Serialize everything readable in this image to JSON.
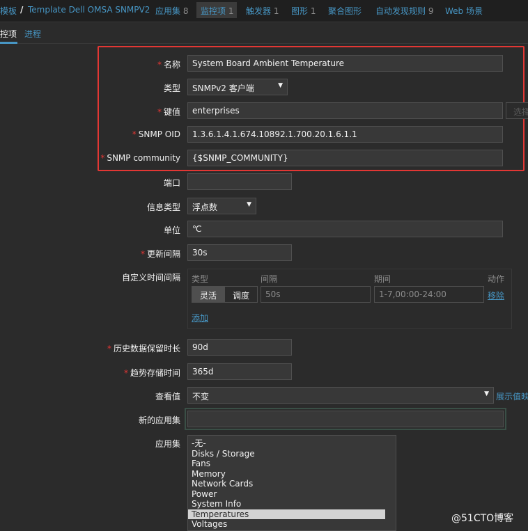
{
  "topnav": {
    "templates": "模板",
    "separator": "/",
    "template_name": "Template Dell OMSA SNMPV2",
    "applications": {
      "label": "应用集",
      "count": "8"
    },
    "items": {
      "label": "监控项",
      "count": "1"
    },
    "triggers": {
      "label": "触发器",
      "count": "1"
    },
    "graphs": {
      "label": "图形",
      "count": "1"
    },
    "screens": {
      "label": "聚合图形"
    },
    "discovery": {
      "label": "自动发现规则",
      "count": "9"
    },
    "web": {
      "label": "Web 场景"
    }
  },
  "subtabs": {
    "item": "监控项",
    "preprocessing": "进程"
  },
  "form": {
    "required_mark": "*",
    "name": {
      "label": "名称",
      "value": "System Board Ambient Temperature"
    },
    "type": {
      "label": "类型",
      "value": "SNMPv2 客户端"
    },
    "key": {
      "label": "键值",
      "value": "enterprises",
      "select_button": "选择"
    },
    "snmp_oid": {
      "label": "SNMP OID",
      "value": "1.3.6.1.4.1.674.10892.1.700.20.1.6.1.1"
    },
    "snmp_community": {
      "label": "SNMP community",
      "value": "{$SNMP_COMMUNITY}"
    },
    "port": {
      "label": "端口",
      "value": ""
    },
    "info_type": {
      "label": "信息类型",
      "value": "浮点数"
    },
    "units": {
      "label": "单位",
      "value": "℃"
    },
    "update_interval": {
      "label": "更新间隔",
      "value": "30s"
    },
    "custom_intervals": {
      "label": "自定义时间间隔",
      "col_type": "类型",
      "col_interval": "间隔",
      "col_period": "期间",
      "col_action": "动作",
      "flexible": "灵活",
      "scheduling": "调度",
      "interval_value": "50s",
      "period_value": "1-7,00:00-24:00",
      "remove": "移除",
      "add": "添加"
    },
    "history": {
      "label": "历史数据保留时长",
      "value": "90d"
    },
    "trends": {
      "label": "趋势存储时间",
      "value": "365d"
    },
    "show_value": {
      "label": "查看值",
      "value": "不变",
      "mapping_link": "展示值映射"
    },
    "new_application": {
      "label": "新的应用集",
      "value": ""
    },
    "applications": {
      "label": "应用集",
      "options": [
        "-无-",
        "Disks / Storage",
        "Fans",
        "Memory",
        "Network Cards",
        "Power",
        "System Info",
        "Temperatures",
        "Voltages"
      ],
      "selected": "Temperatures"
    }
  },
  "watermark": "@51CTO博客",
  "colors": {
    "background": "#2b2b2b",
    "accent": "#4796c4",
    "highlight": "#e33734"
  }
}
